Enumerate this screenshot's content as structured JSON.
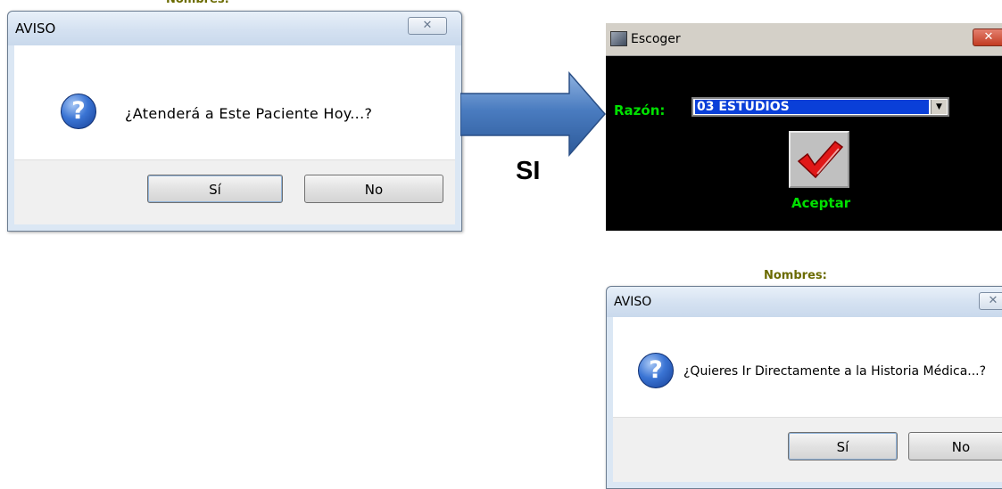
{
  "dialog_atender": {
    "title": "AVISO",
    "close_glyph": "✕",
    "icon": "question-icon",
    "message": "¿Atenderá a Este Paciente Hoy...?",
    "yes_label": "Sí",
    "no_label": "No"
  },
  "arrow_label": "SI",
  "escoger": {
    "title": "Escoger",
    "close_glyph": "✕",
    "razon_label": "Razón:",
    "razon_value": "03 ESTUDIOS",
    "accept_label": "Aceptar",
    "label_color": "#00e000",
    "background": "#000000"
  },
  "dialog_historia": {
    "title": "AVISO",
    "close_glyph": "✕",
    "icon": "question-icon",
    "message": "¿Quieres Ir Directamente a la Historia Médica...?",
    "yes_label": "Sí",
    "no_label": "No"
  },
  "background_text": {
    "nombres": "Nombres:"
  },
  "colors": {
    "arrow_blue": "#3f6fb0",
    "dialog_frame": "#dbe7f4"
  }
}
